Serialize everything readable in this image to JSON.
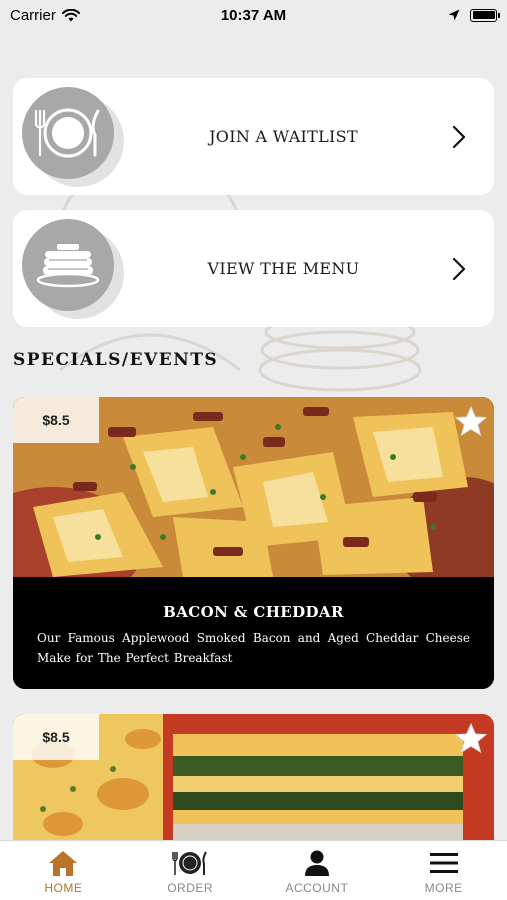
{
  "status_bar": {
    "carrier": "Carrier",
    "time": "10:37 AM"
  },
  "actions": [
    {
      "label": "JOIN A WAITLIST",
      "icon": "plate-cutlery-icon"
    },
    {
      "label": "VIEW THE MENU",
      "icon": "pancake-stack-icon"
    }
  ],
  "section_title": "SPECIALS/EVENTS",
  "specials": [
    {
      "price": "$8.5",
      "name": "BACON & CHEDDAR",
      "description": "Our Famous Applewood Smoked Bacon and Aged Cheddar Cheese Make for The Perfect Breakfast"
    },
    {
      "price": "$8.5"
    }
  ],
  "tabs": [
    {
      "label": "HOME",
      "icon": "home-icon",
      "active": true
    },
    {
      "label": "ORDER",
      "icon": "plate-cutlery-icon",
      "active": false
    },
    {
      "label": "ACCOUNT",
      "icon": "person-icon",
      "active": false
    },
    {
      "label": "MORE",
      "icon": "menu-icon",
      "active": false
    }
  ],
  "colors": {
    "accent": "#b8742a",
    "icon_circle": "#a9a8a8",
    "background": "#ececec"
  }
}
